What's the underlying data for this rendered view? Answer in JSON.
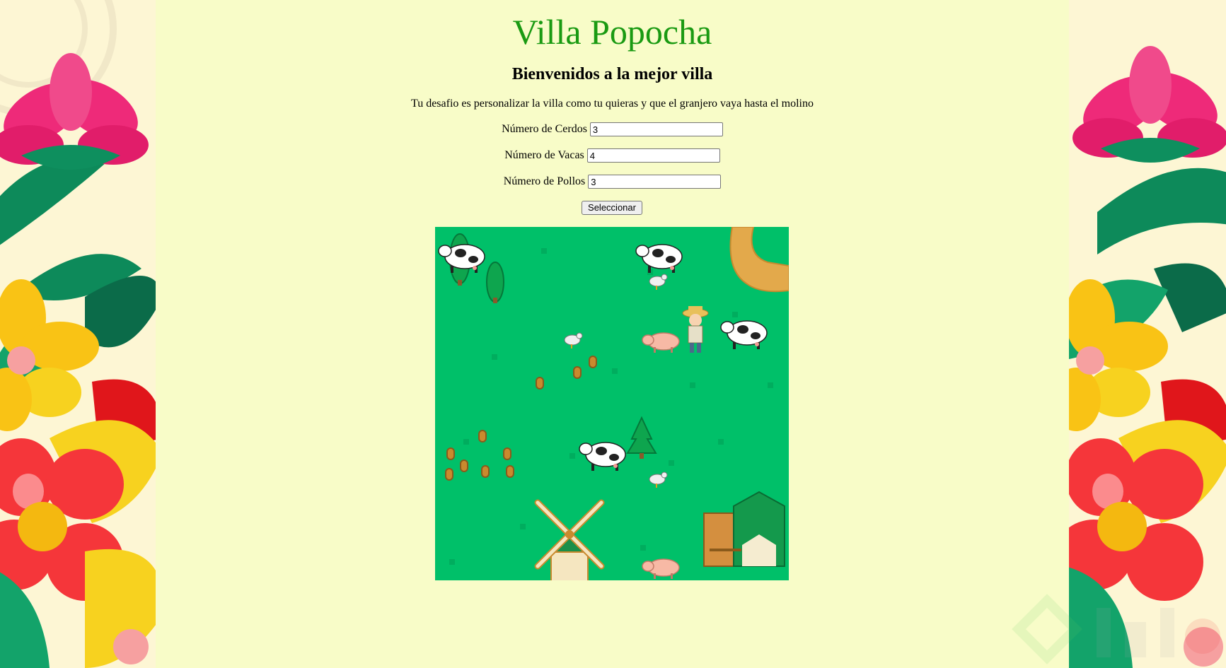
{
  "page": {
    "title": "Villa Popocha",
    "subtitle": "Bienvenidos a la mejor villa",
    "description": "Tu desafio es personalizar la villa como tu quieras y que el granjero vaya hasta el molino"
  },
  "form": {
    "pigs": {
      "label": "Número de Cerdos",
      "value": "3"
    },
    "cows": {
      "label": "Número de Vacas",
      "value": "4"
    },
    "chickens": {
      "label": "Número de Pollos",
      "value": "3"
    },
    "submit_label": "Seleccionar"
  },
  "game": {
    "counts_shown": {
      "cows": 4,
      "pigs": 2,
      "chickens": 3,
      "farmer": 1
    },
    "icons": [
      "cow-icon",
      "pig-icon",
      "chicken-icon",
      "farmer-icon",
      "windmill-icon",
      "barn-icon",
      "tree-icon",
      "hay-icon",
      "path-icon"
    ]
  },
  "colors": {
    "title": "#1a9a12",
    "page_bg": "#f8fcc8",
    "grass": "#00c069",
    "path": "#e3a94b"
  }
}
